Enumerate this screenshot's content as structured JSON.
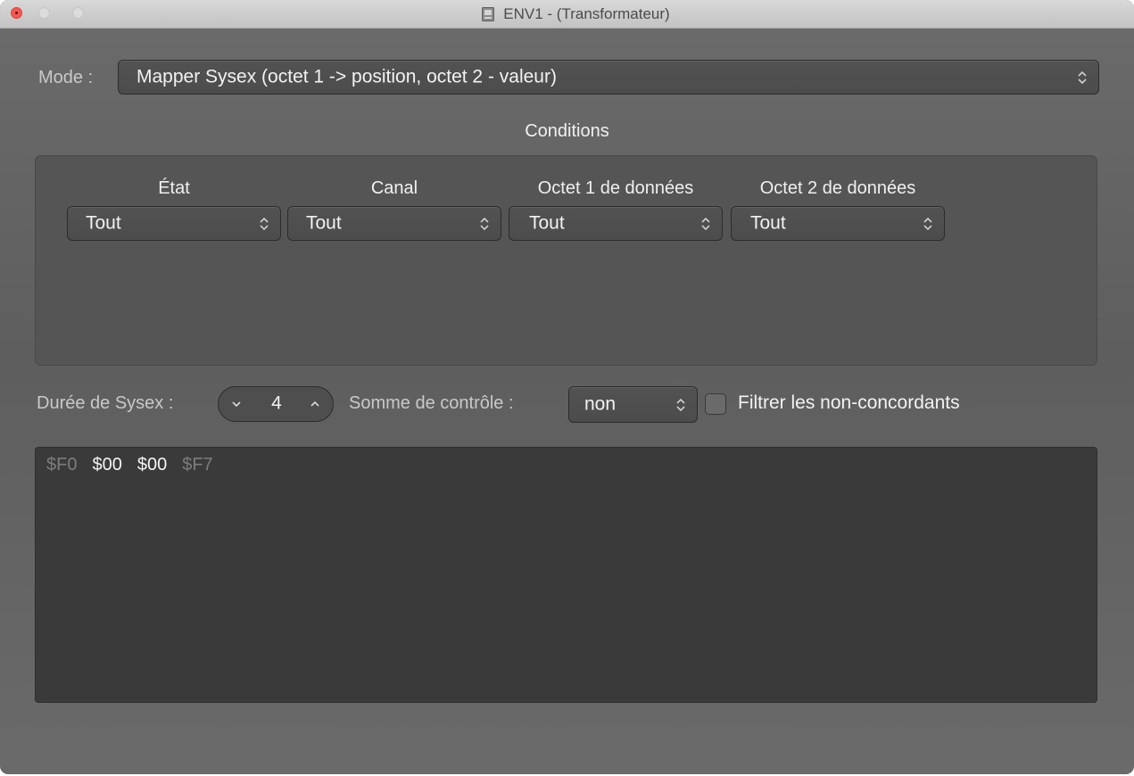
{
  "window": {
    "title": "ENV1 - (Transformateur)"
  },
  "mode": {
    "label": "Mode :",
    "value": "Mapper Sysex (octet 1 -> position, octet 2 - valeur)"
  },
  "conditions": {
    "title": "Conditions",
    "columns": [
      {
        "header": "État",
        "value": "Tout"
      },
      {
        "header": "Canal",
        "value": "Tout"
      },
      {
        "header": "Octet 1 de données",
        "value": "Tout"
      },
      {
        "header": "Octet 2 de données",
        "value": "Tout"
      }
    ]
  },
  "sysex_length": {
    "label": "Durée de Sysex :",
    "value": "4"
  },
  "checksum": {
    "label": "Somme de contrôle :",
    "value": "non"
  },
  "filter": {
    "label": "Filtrer les non-concordants",
    "checked": false
  },
  "sysex_bytes": [
    {
      "text": "$F0",
      "fixed": true
    },
    {
      "text": "$00",
      "fixed": false
    },
    {
      "text": "$00",
      "fixed": false
    },
    {
      "text": "$F7",
      "fixed": true
    }
  ],
  "colors": {
    "window_background": "#5e5e5e",
    "panel_background": "#555555",
    "sysex_background": "#3a3a3a",
    "close_button": "#f25953"
  },
  "icons": {
    "popup": "updown-chevron-icon",
    "stepper_down": "chevron-down-icon",
    "stepper_up": "chevron-up-icon",
    "document": "document-icon"
  }
}
